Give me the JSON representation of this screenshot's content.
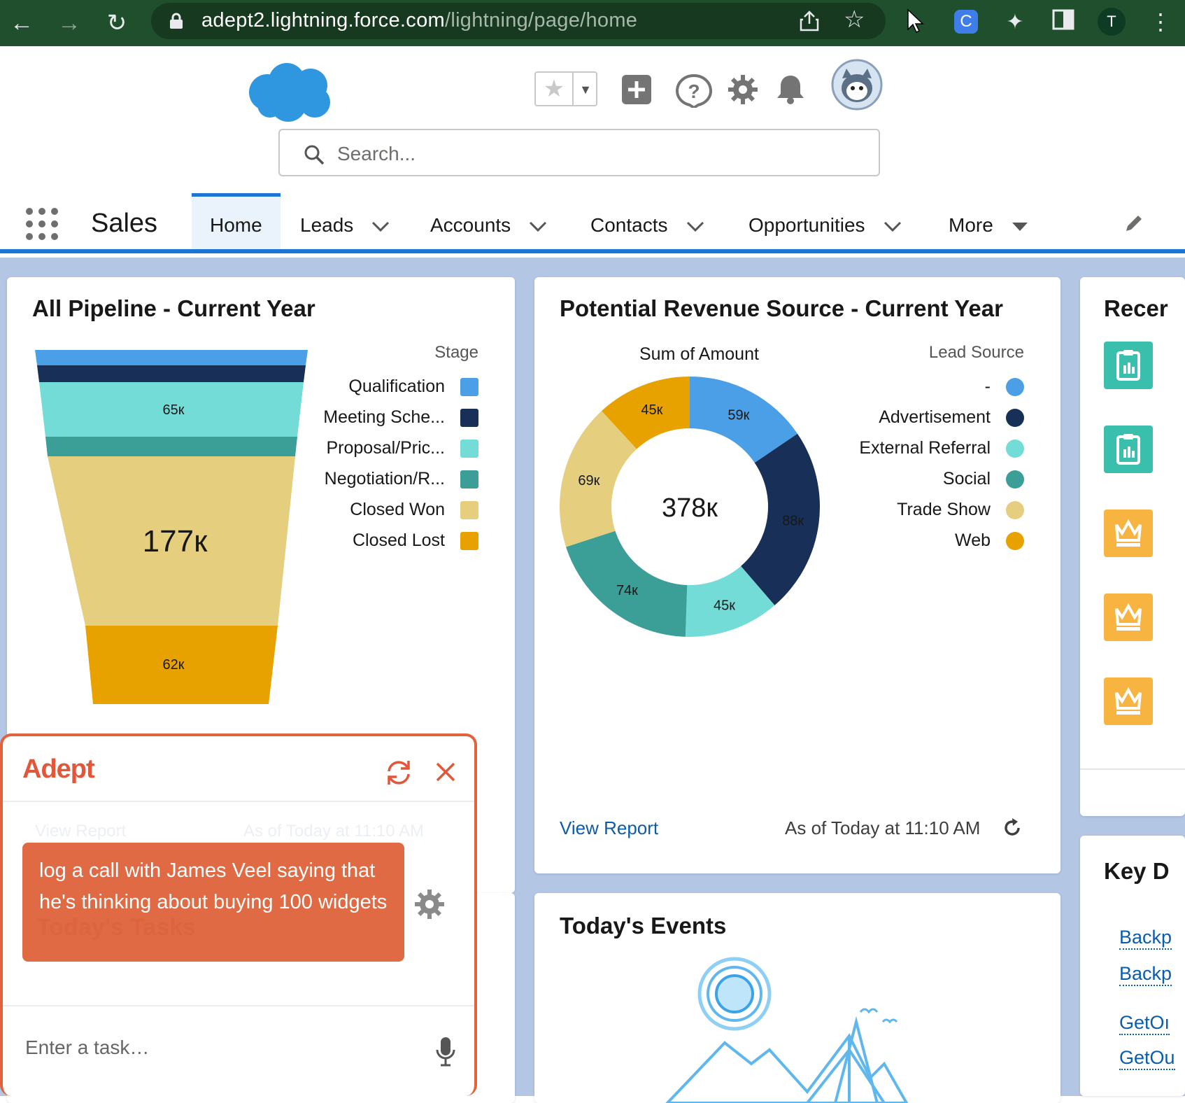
{
  "browser": {
    "url_host": "adept2.lightning.force.com",
    "url_path": "/lightning/page/home",
    "profile_initial": "T",
    "extension_letter": "C"
  },
  "header": {
    "search_placeholder": "Search..."
  },
  "nav": {
    "app_name": "Sales",
    "tabs": [
      {
        "label": "Home"
      },
      {
        "label": "Leads"
      },
      {
        "label": "Accounts"
      },
      {
        "label": "Contacts"
      },
      {
        "label": "Opportunities"
      },
      {
        "label": "More"
      }
    ]
  },
  "pipeline": {
    "title": "All Pipeline - Current Year",
    "legend_title": "Stage",
    "labels": {
      "proposal": "65к",
      "closed_won": "177к",
      "closed_lost": "62к"
    },
    "legend": [
      {
        "label": "Qualification",
        "color": "#4b9fe6"
      },
      {
        "label": "Meeting Sche...",
        "color": "#182f57"
      },
      {
        "label": "Proposal/Pric...",
        "color": "#74dcd7"
      },
      {
        "label": "Negotiation/R...",
        "color": "#3b9e97"
      },
      {
        "label": "Closed Won",
        "color": "#e6ce7f"
      },
      {
        "label": "Closed Lost",
        "color": "#e8a200"
      }
    ]
  },
  "revenue": {
    "title": "Potential Revenue Source - Current Year",
    "measure_label": "Sum of Amount",
    "legend_title": "Lead Source",
    "total": "378к",
    "legend": [
      {
        "label": "-",
        "color": "#4b9fe6"
      },
      {
        "label": "Advertisement",
        "color": "#182f57"
      },
      {
        "label": "External Referral",
        "color": "#74dcd7"
      },
      {
        "label": "Social",
        "color": "#3b9e97"
      },
      {
        "label": "Trade Show",
        "color": "#e6ce7f"
      },
      {
        "label": "Web",
        "color": "#e8a200"
      }
    ],
    "view_report": "View Report",
    "as_of": "As of Today at 11:10 AM"
  },
  "chart_data": [
    {
      "type": "bar",
      "title": "All Pipeline - Current Year",
      "categories": [
        "Qualification",
        "Meeting Sche...",
        "Proposal/Pric...",
        "Negotiation/R...",
        "Closed Won",
        "Closed Lost"
      ],
      "values": [
        null,
        null,
        65,
        null,
        177,
        62
      ],
      "value_labels": [
        "",
        "",
        "65к",
        "",
        "177к",
        "62к"
      ],
      "legend_placement": "right"
    },
    {
      "type": "pie",
      "title": "Potential Revenue Source - Current Year",
      "categories": [
        "-",
        "Advertisement",
        "External Referral",
        "Social",
        "Trade Show",
        "Web"
      ],
      "values": [
        59,
        88,
        45,
        74,
        69,
        45
      ],
      "value_labels": [
        "59к",
        "88к",
        "45к",
        "74к",
        "69к",
        "45к"
      ],
      "center_label": "378к",
      "legend_placement": "right"
    }
  ],
  "events": {
    "title": "Today's Events"
  },
  "recent": {
    "title": "Recer"
  },
  "key_deals": {
    "title": "Key D",
    "links": [
      "Backp",
      "Backp",
      "GetOı",
      "GetOu"
    ]
  },
  "adept": {
    "logo": "Adept",
    "message": "log a call with James Veel saying that he's thinking about buying 100 widgets",
    "input_placeholder": "Enter a task…",
    "ghost_view_report": "View Report",
    "ghost_as_of": "As of Today at 11:10 AM",
    "ghost_tasks": "Today's Tasks"
  }
}
